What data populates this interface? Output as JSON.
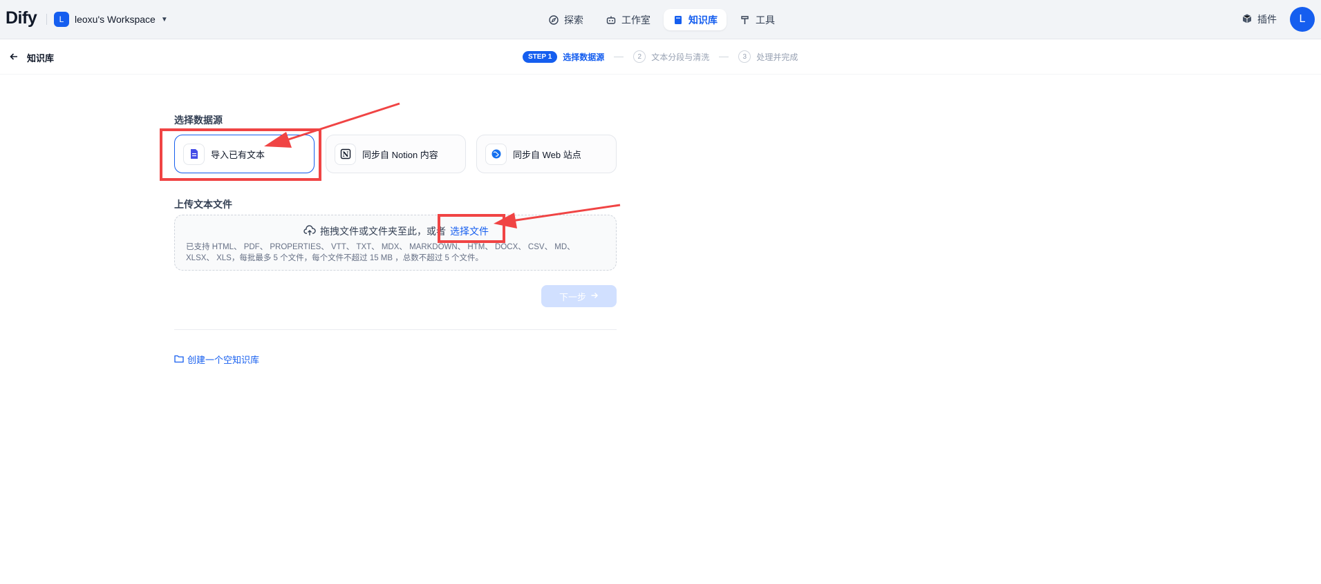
{
  "brand": {
    "logo_text": "Dify",
    "workspace_initial": "L",
    "workspace_name": "leoxu's Workspace"
  },
  "nav": {
    "items": [
      {
        "label": "探索",
        "icon": "compass-icon",
        "active": false
      },
      {
        "label": "工作室",
        "icon": "robot-icon",
        "active": false
      },
      {
        "label": "知识库",
        "icon": "book-icon",
        "active": true
      },
      {
        "label": "工具",
        "icon": "hammer-icon",
        "active": false
      }
    ]
  },
  "header_right": {
    "plugins_label": "插件",
    "avatar_initial": "L"
  },
  "subheader": {
    "back_label": "知识库",
    "steps": [
      {
        "badge": "STEP 1",
        "label": "选择数据源",
        "active": true
      },
      {
        "num": "2",
        "label": "文本分段与清洗",
        "active": false
      },
      {
        "num": "3",
        "label": "处理并完成",
        "active": false
      }
    ]
  },
  "main": {
    "datasource_title": "选择数据源",
    "sources": [
      {
        "label": "导入已有文本",
        "icon": "file-text-icon",
        "selected": true
      },
      {
        "label": "同步自 Notion 内容",
        "icon": "notion-icon",
        "selected": false
      },
      {
        "label": "同步自 Web 站点",
        "icon": "globe-icon",
        "selected": false
      }
    ],
    "upload_title": "上传文本文件",
    "upload_prompt": "拖拽文件或文件夹至此，或者",
    "upload_link": "选择文件",
    "upload_hint": "已支持 HTML、 PDF、 PROPERTIES、 VTT、 TXT、 MDX、 MARKDOWN、 HTM、 DOCX、 CSV、 MD、 XLSX、 XLS，每批最多 5 个文件，每个文件不超过 15 MB ，总数不超过 5 个文件。",
    "next_button": "下一步",
    "create_empty": "创建一个空知识库"
  },
  "colors": {
    "accent": "#155EEF",
    "annotation_red": "#F04444",
    "disabled_button": "#D1E0FF"
  }
}
